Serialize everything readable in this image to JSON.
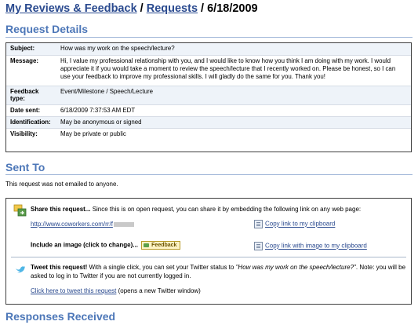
{
  "breadcrumb": {
    "link1": "My Reviews & Feedback",
    "sep1": " / ",
    "link2": "Requests",
    "sep2": " / ",
    "current": "6/18/2009"
  },
  "request_details": {
    "title": "Request Details",
    "rows": [
      {
        "label": "Subject:",
        "value": "How was my work on the speech/lecture?"
      },
      {
        "label": "Message:",
        "value": "Hi,  I value my professional relationship with you, and I would like to know how you think I am doing with my work.  I would appreciate it if you would take a moment to review the speech/lecture that I recently worked on.  Please be honest, so I can use your feedback to improve my professional skills.  I will gladly do the same for you.  Thank you!"
      },
      {
        "label": "Feedback type:",
        "value": "Event/Milestone / Speech/Lecture"
      },
      {
        "label": "Date sent:",
        "value": "6/18/2009 7:37:53 AM EDT"
      },
      {
        "label": "Identification:",
        "value": "May be anonymous or signed"
      },
      {
        "label": "Visibility:",
        "value": "May be private or public"
      }
    ]
  },
  "sent_to": {
    "title": "Sent To",
    "text": "This request was not emailed to anyone."
  },
  "share": {
    "heading": "Share this request...",
    "description": " Since this is on open request, you can share it by embedding the following link on any web page:",
    "link_url": "http://www.coworkers.com/rr/f",
    "copy_link": "Copy link to my clipboard",
    "include_image_label": "Include an image (click to change)...",
    "badge_text": "Feedback",
    "copy_image_link": "Copy link with image to my clipboard"
  },
  "tweet": {
    "heading": "Tweet this request!",
    "text_before": " With a single click, you can set your Twitter status to ",
    "status_text": "\"How was my work on the speech/lecture?\"",
    "text_after": ". Note: you will be asked to log in to Twitter if you are not currently logged in.",
    "link": "Click here to tweet this request",
    "link_note": " (opens a new Twitter window)"
  },
  "responses": {
    "title": "Responses Received"
  },
  "colors": {
    "section_title": "#4d77b8",
    "link": "#2a4a8f",
    "row_stripe": "#eef3f9"
  }
}
